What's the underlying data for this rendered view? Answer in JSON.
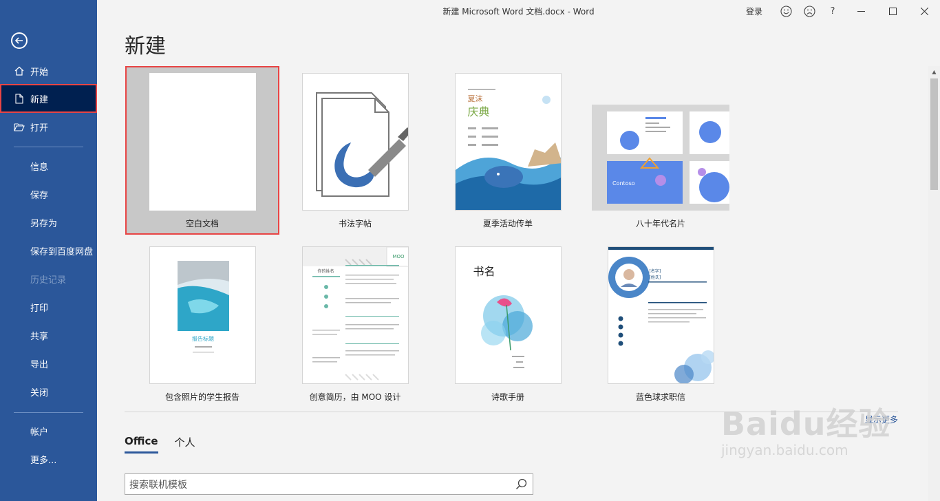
{
  "window": {
    "title": "新建 Microsoft Word 文档.docx  -  Word",
    "signin": "登录",
    "help": "?"
  },
  "sidebar": {
    "items": [
      {
        "label": "开始",
        "icon": "home-icon"
      },
      {
        "label": "新建",
        "icon": "new-document-icon",
        "active": true
      },
      {
        "label": "打开",
        "icon": "open-folder-icon"
      },
      {
        "label": "信息"
      },
      {
        "label": "保存"
      },
      {
        "label": "另存为"
      },
      {
        "label": "保存到百度网盘"
      },
      {
        "label": "历史记录",
        "disabled": true
      },
      {
        "label": "打印"
      },
      {
        "label": "共享"
      },
      {
        "label": "导出"
      },
      {
        "label": "关闭"
      },
      {
        "label": "帐户"
      },
      {
        "label": "更多..."
      }
    ]
  },
  "main": {
    "title": "新建",
    "templates": [
      {
        "label": "空白文档"
      },
      {
        "label": "书法字帖"
      },
      {
        "label": "夏季活动传单",
        "thumb_title1": "夏沫",
        "thumb_title2": "庆典"
      },
      {
        "label": "八十年代名片",
        "thumb_text": "Contoso"
      },
      {
        "label": "包含照片的学生报告",
        "thumb_title": "报告标题"
      },
      {
        "label": "创意简历，由 MOO 设计",
        "thumb_badge": "MOO",
        "thumb_name": "你的姓名"
      },
      {
        "label": "诗歌手册",
        "thumb_title": "书名"
      },
      {
        "label": "蓝色球求职信",
        "thumb_name": "[名字]",
        "thumb_surname": "[姓氏]"
      }
    ],
    "show_more": "显示更多",
    "tabs": [
      {
        "label": "Office",
        "active": true
      },
      {
        "label": "个人"
      }
    ],
    "search_placeholder": "搜索联机模板"
  },
  "watermark": {
    "main": "Baidu经验",
    "sub": "jingyan.baidu.com"
  },
  "colors": {
    "sidebar": "#2b579a",
    "sidebar_active": "#002050",
    "highlight": "#e84444",
    "accent": "#2b579a"
  }
}
